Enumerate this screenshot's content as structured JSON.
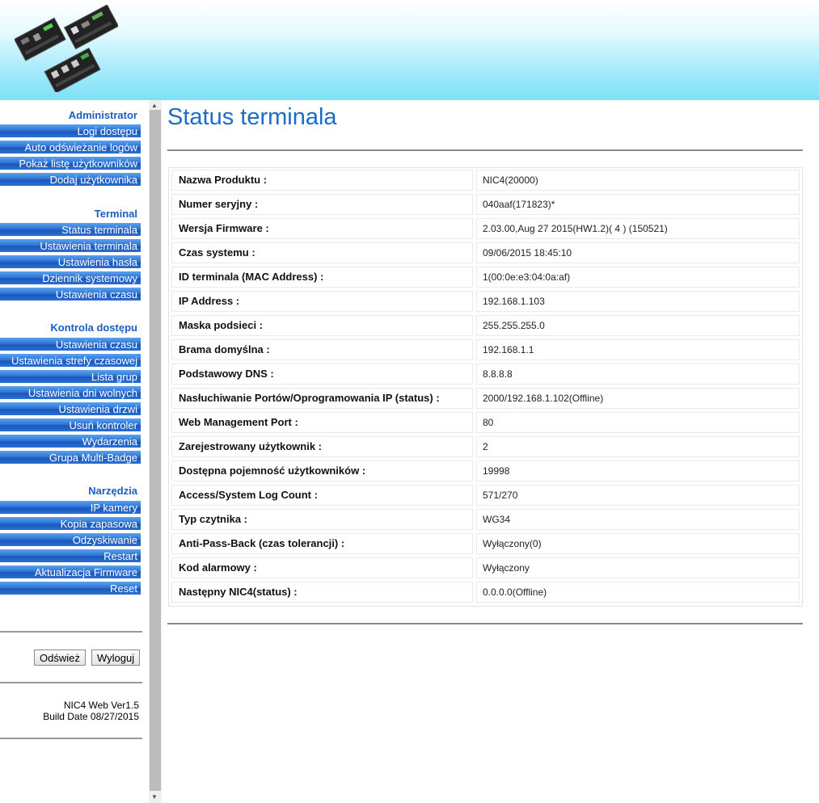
{
  "sidebar": {
    "sections": [
      {
        "title": "Administrator",
        "items": [
          "Logi dostępu",
          "Auto odświeżanie logów",
          "Pokaż listę użytkowników",
          "Dodaj użytkownika"
        ]
      },
      {
        "title": "Terminal",
        "items": [
          "Status terminala",
          "Ustawienia terminala",
          "Ustawienia hasła",
          "Dziennik systemowy",
          "Ustawienia czasu"
        ]
      },
      {
        "title": "Kontrola dostępu",
        "items": [
          "Ustawienia czasu",
          "Ustawienia strefy czasowej",
          "Lista grup",
          "Ustawienia dni wolnych",
          "Ustawienia drzwi",
          "Usuń kontroler",
          "Wydarzenia",
          "Grupa Multi-Badge"
        ]
      },
      {
        "title": "Narzędzia",
        "items": [
          "IP kamery",
          "Kopia zapasowa",
          "Odzyskiwanie",
          "Restart",
          "Aktualizacja Firmware",
          "Reset"
        ]
      }
    ],
    "refresh_button": "Odśwież",
    "logout_button": "Wyloguj",
    "version_line1": "NIC4 Web Ver1.5",
    "version_line2": "Build Date 08/27/2015"
  },
  "main": {
    "title": "Status terminala",
    "rows": [
      {
        "label": "Nazwa Produktu :",
        "value": "NIC4(20000)"
      },
      {
        "label": "Numer seryjny :",
        "value": "040aaf(171823)*"
      },
      {
        "label": "Wersja Firmware :",
        "value": "2.03.00,Aug 27 2015(HW1.2)( 4 ) (150521)"
      },
      {
        "label": "Czas systemu :",
        "value": "09/06/2015 18:45:10"
      },
      {
        "label": "ID terminala (MAC Address) :",
        "value": "1(00:0e:e3:04:0a:af)"
      },
      {
        "label": "IP Address :",
        "value": "192.168.1.103"
      },
      {
        "label": "Maska podsieci :",
        "value": "255.255.255.0"
      },
      {
        "label": "Brama domyślna :",
        "value": "192.168.1.1"
      },
      {
        "label": "Podstawowy DNS :",
        "value": "8.8.8.8"
      },
      {
        "label": "Nasłuchiwanie Portów/Oprogramowania IP (status) :",
        "value": "2000/192.168.1.102(Offline)"
      },
      {
        "label": "Web Management Port :",
        "value": "80"
      },
      {
        "label": "Zarejestrowany użytkownik :",
        "value": "2"
      },
      {
        "label": "Dostępna pojemność użytkowników :",
        "value": "19998"
      },
      {
        "label": "Access/System Log Count :",
        "value": "571/270"
      },
      {
        "label": "Typ czytnika :",
        "value": "WG34"
      },
      {
        "label": "Anti-Pass-Back (czas tolerancji) :",
        "value": "Wyłączony(0)"
      },
      {
        "label": "Kod alarmowy :",
        "value": "Wyłączony"
      },
      {
        "label": "Następny NIC4(status) :",
        "value": "0.0.0.0(Offline)"
      }
    ]
  },
  "colors": {
    "accent": "#1c6bc7",
    "menu_bar": "#2a6fd6",
    "header_gradient_end": "#7fe0f7"
  }
}
